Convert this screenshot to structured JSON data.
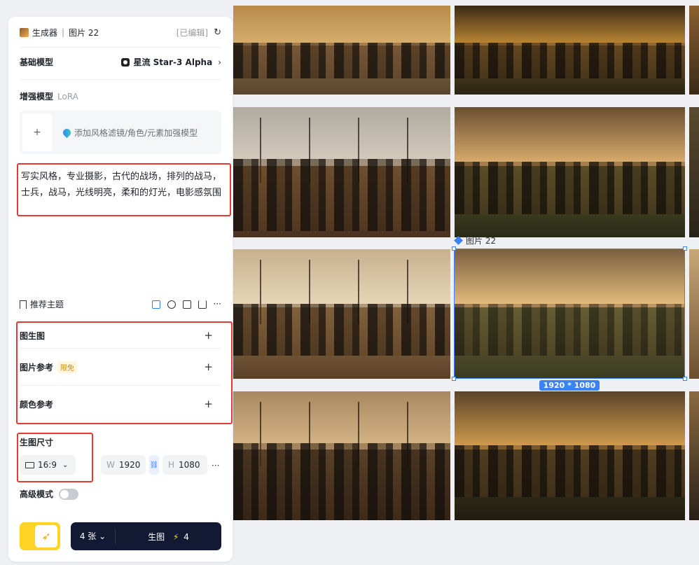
{
  "header": {
    "title": "生成器",
    "image_name": "图片 22",
    "status": "[已编辑]"
  },
  "base_model": {
    "label": "基础模型",
    "value": "星流 Star-3 Alpha"
  },
  "enhance_model": {
    "label": "增强模型",
    "sub_label": "LoRA",
    "hint": "添加风格滤镜/角色/元素加强模型"
  },
  "prompt": {
    "text": "写实风格，专业摄影，古代的战场，排列的战马，士兵，战马，光线明亮，柔和的灯光，电影感氛围"
  },
  "recommend": {
    "label": "推荐主题"
  },
  "sections": [
    {
      "label": "图生图"
    },
    {
      "label": "图片参考",
      "badge": "限免"
    },
    {
      "label": "颜色参考"
    }
  ],
  "size": {
    "label": "生图尺寸",
    "ratio": "16:9",
    "width_label": "W",
    "width": "1920",
    "height_label": "H",
    "height": "1080"
  },
  "advanced": {
    "label": "高级模式"
  },
  "generate": {
    "count": "4 张",
    "label": "生图",
    "cost": "4"
  },
  "canvas": {
    "selected_label": "图片 22",
    "selected_size": "1920 * 1080"
  }
}
